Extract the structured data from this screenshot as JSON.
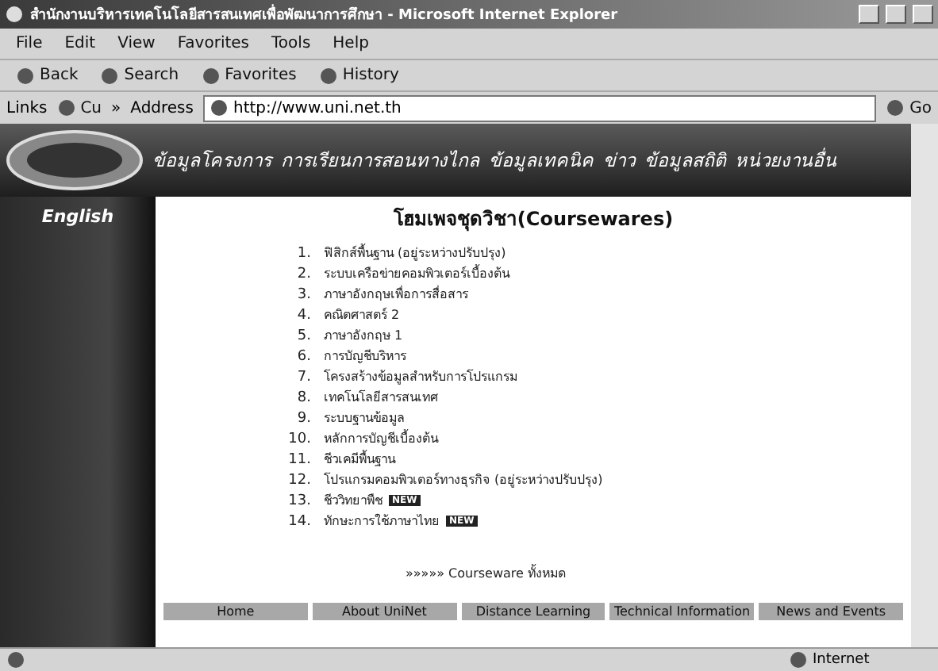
{
  "window": {
    "title": "สำนักงานบริหารเทคโนโลยีสารสนเทศเพื่อพัฒนาการศึกษา - Microsoft Internet Explorer"
  },
  "menu": [
    "File",
    "Edit",
    "View",
    "Favorites",
    "Tools",
    "Help"
  ],
  "toolbar": [
    "Back",
    "Search",
    "Favorites",
    "History"
  ],
  "address_bar": {
    "links_label": "Links",
    "link": "Cu",
    "more": "»",
    "label": "Address",
    "url": "http://www.uni.net.th",
    "go": "Go"
  },
  "page": {
    "nav": [
      "ข้อมูลโครงการ",
      "การเรียนการสอนทางไกล",
      "ข้อมูลเทคนิค",
      "ข่าว",
      "ข้อมูลสถิติ",
      "หน่วยงานอื่น"
    ],
    "sidebar_link": "English",
    "heading": "โฮมเพจชุดวิชา(Coursewares)",
    "courses": [
      {
        "number": "1.",
        "title": "ฟิสิกส์พื้นฐาน (อยู่ระหว่างปรับปรุง)"
      },
      {
        "number": "2.",
        "title": "ระบบเครือข่ายคอมพิวเตอร์เบื้องต้น"
      },
      {
        "number": "3.",
        "title": "ภาษาอังกฤษเพื่อการสื่อสาร"
      },
      {
        "number": "4.",
        "title": "คณิตศาสตร์ 2"
      },
      {
        "number": "5.",
        "title": "ภาษาอังกฤษ 1"
      },
      {
        "number": "6.",
        "title": "การบัญชีบริหาร"
      },
      {
        "number": "7.",
        "title": "โครงสร้างข้อมูลสำหรับการโปรแกรม"
      },
      {
        "number": "8.",
        "title": "เทคโนโลยีสารสนเทศ"
      },
      {
        "number": "9.",
        "title": "ระบบฐานข้อมูล"
      },
      {
        "number": "10.",
        "title": "หลักการบัญชีเบื้องต้น"
      },
      {
        "number": "11.",
        "title": "ชีวเคมีพื้นฐาน"
      },
      {
        "number": "12.",
        "title": "โปรแกรมคอมพิวเตอร์ทางธุรกิจ (อยู่ระหว่างปรับปรุง)"
      },
      {
        "number": "13.",
        "title": "ชีววิทยาพืช",
        "badge": "NEW"
      },
      {
        "number": "14.",
        "title": "ทักษะการใช้ภาษาไทย",
        "badge": "NEW"
      }
    ],
    "all_link": "»»»»» Courseware ทั้งหมด",
    "footer_nav": [
      "Home",
      "About UniNet",
      "Distance Learning",
      "Technical Information",
      "News and Events"
    ]
  },
  "status_bar": {
    "zone": "Internet"
  }
}
